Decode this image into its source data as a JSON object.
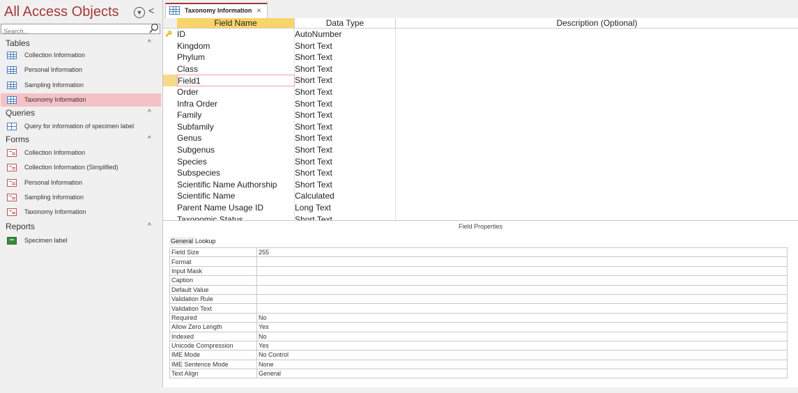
{
  "nav": {
    "title": "All Access Objects",
    "search_placeholder": "Search...",
    "groups": [
      {
        "label": "Tables",
        "items": [
          "Collection Information",
          "Personal Information",
          "Sampling Information",
          "Taxonomy Information"
        ]
      },
      {
        "label": "Queries",
        "items": [
          "Query for information of specimen label"
        ]
      },
      {
        "label": "Forms",
        "items": [
          "Collection Information",
          "Collection Information (Simplified)",
          "Personal Information",
          "Sampling Information",
          "Taxonomy Information"
        ]
      },
      {
        "label": "Reports",
        "items": [
          "Specimen label"
        ]
      }
    ],
    "selected_item": "Taxonomy Information"
  },
  "tab": {
    "title": "Taxonomy Information",
    "close": "×"
  },
  "grid": {
    "headers": {
      "field": "Field Name",
      "type": "Data Type",
      "desc": "Description (Optional)"
    },
    "rows": [
      {
        "name": "ID",
        "type": "AutoNumber"
      },
      {
        "name": "Kingdom",
        "type": "Short Text"
      },
      {
        "name": "Phylum",
        "type": "Short Text"
      },
      {
        "name": "Class",
        "type": "Short Text"
      },
      {
        "name": "Field1",
        "type": "Short Text"
      },
      {
        "name": "Order",
        "type": "Short Text"
      },
      {
        "name": "Infra Order",
        "type": "Short Text"
      },
      {
        "name": "Family",
        "type": "Short Text"
      },
      {
        "name": "Subfamily",
        "type": "Short Text"
      },
      {
        "name": "Genus",
        "type": "Short Text"
      },
      {
        "name": "Subgenus",
        "type": "Short Text"
      },
      {
        "name": "Species",
        "type": "Short Text"
      },
      {
        "name": "Subspecies",
        "type": "Short Text"
      },
      {
        "name": "Scientific Name Authorship",
        "type": "Short Text"
      },
      {
        "name": "Scientific Name",
        "type": "Calculated"
      },
      {
        "name": "Parent Name Usage ID",
        "type": "Long Text"
      },
      {
        "name": "Taxonomic Status",
        "type": "Short Text"
      }
    ]
  },
  "props": {
    "caption": "Field Properties",
    "tabs": [
      "General",
      "Lookup"
    ],
    "rows": [
      {
        "label": "Field Size",
        "value": "255"
      },
      {
        "label": "Format",
        "value": ""
      },
      {
        "label": "Input Mask",
        "value": ""
      },
      {
        "label": "Caption",
        "value": ""
      },
      {
        "label": "Default Value",
        "value": ""
      },
      {
        "label": "Validation Rule",
        "value": ""
      },
      {
        "label": "Validation Text",
        "value": ""
      },
      {
        "label": "Required",
        "value": "No"
      },
      {
        "label": "Allow Zero Length",
        "value": "Yes"
      },
      {
        "label": "Indexed",
        "value": "No"
      },
      {
        "label": "Unicode Compression",
        "value": "Yes"
      },
      {
        "label": "IME Mode",
        "value": "No Control"
      },
      {
        "label": "IME Sentence Mode",
        "value": "None"
      },
      {
        "label": "Text Align",
        "value": "General"
      }
    ]
  }
}
